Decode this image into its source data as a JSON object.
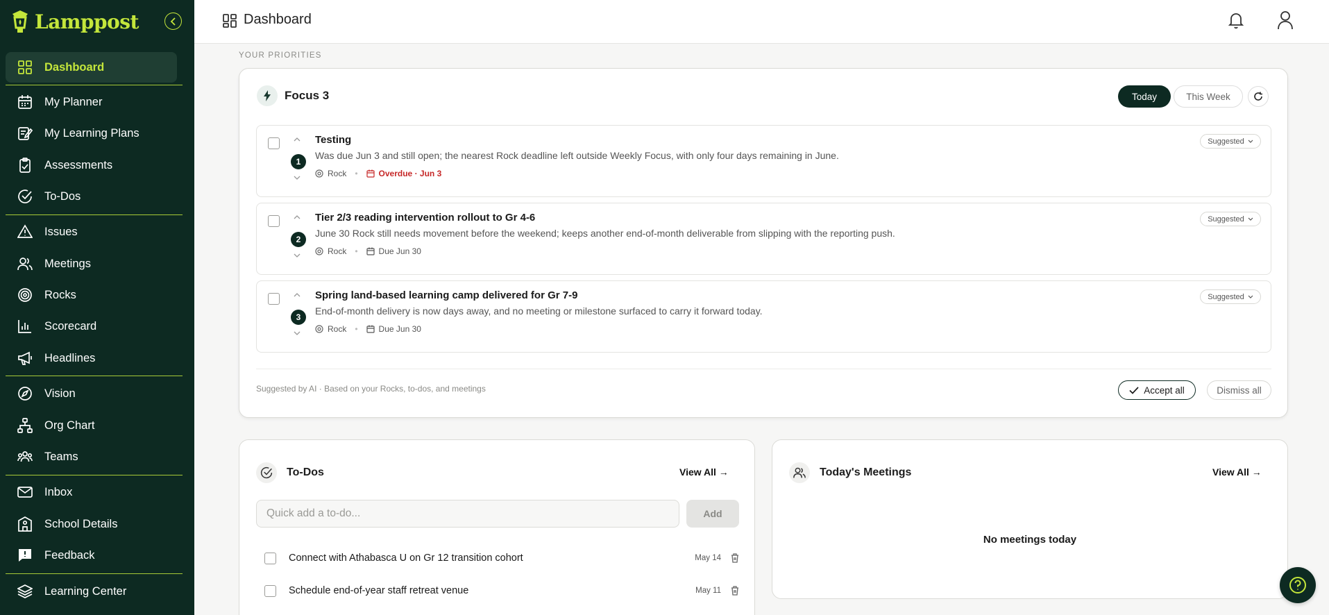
{
  "app": {
    "name": "Lamppost"
  },
  "header": {
    "title": "Dashboard"
  },
  "sidebar": {
    "items": [
      {
        "label": "Dashboard",
        "icon": "dashboard-icon",
        "active": true
      },
      {
        "label": "My Planner",
        "icon": "calendar-icon"
      },
      {
        "label": "My Learning Plans",
        "icon": "edit-note-icon"
      },
      {
        "label": "Assessments",
        "icon": "clipboard-icon"
      },
      {
        "label": "To-Dos",
        "icon": "check-circle-icon"
      },
      {
        "label": "Issues",
        "icon": "warning-icon"
      },
      {
        "label": "Meetings",
        "icon": "users-icon"
      },
      {
        "label": "Rocks",
        "icon": "target-icon"
      },
      {
        "label": "Scorecard",
        "icon": "bar-chart-icon"
      },
      {
        "label": "Headlines",
        "icon": "megaphone-icon"
      },
      {
        "label": "Vision",
        "icon": "compass-icon"
      },
      {
        "label": "Org Chart",
        "icon": "org-chart-icon"
      },
      {
        "label": "Teams",
        "icon": "team-icon"
      },
      {
        "label": "Inbox",
        "icon": "mail-icon"
      },
      {
        "label": "School Details",
        "icon": "school-icon"
      },
      {
        "label": "Feedback",
        "icon": "feedback-icon"
      },
      {
        "label": "Learning Center",
        "icon": "layers-icon"
      }
    ]
  },
  "priorities": {
    "section_label": "YOUR PRIORITIES",
    "title": "Focus 3",
    "tabs": {
      "today": "Today",
      "week": "This Week"
    },
    "items": [
      {
        "rank": "1",
        "title": "Testing",
        "description": "Was due Jun 3 and still open; the nearest Rock deadline left outside Weekly Focus, with only four days remaining in June.",
        "type": "Rock",
        "due": "Overdue · Jun 3",
        "overdue": true,
        "tag": "Suggested"
      },
      {
        "rank": "2",
        "title": "Tier 2/3 reading intervention rollout to Gr 4-6",
        "description": "June 30 Rock still needs movement before the weekend; keeps another end-of-month deliverable from slipping with the reporting push.",
        "type": "Rock",
        "due": "Due Jun 30",
        "overdue": false,
        "tag": "Suggested"
      },
      {
        "rank": "3",
        "title": "Spring land-based learning camp delivered for Gr 7-9",
        "description": "End-of-month delivery is now days away, and no meeting or milestone surfaced to carry it forward today.",
        "type": "Rock",
        "due": "Due Jun 30",
        "overdue": false,
        "tag": "Suggested"
      }
    ],
    "ai_note": "Suggested by AI · Based on your Rocks, to-dos, and meetings",
    "accept_all": "Accept all",
    "dismiss_all": "Dismiss all"
  },
  "todos": {
    "title": "To-Dos",
    "view_all": "View All →",
    "placeholder": "Quick add a to-do...",
    "add_label": "Add",
    "items": [
      {
        "text": "Connect with Athabasca U on Gr 12 transition cohort",
        "date": "May 14"
      },
      {
        "text": "Schedule end-of-year staff retreat venue",
        "date": "May 11"
      }
    ]
  },
  "meetings": {
    "title": "Today's Meetings",
    "view_all": "View All →",
    "empty": "No meetings today"
  },
  "colors": {
    "sidebar": "#0d2a22",
    "accent": "#c4e63b",
    "overdue": "#c62828"
  }
}
